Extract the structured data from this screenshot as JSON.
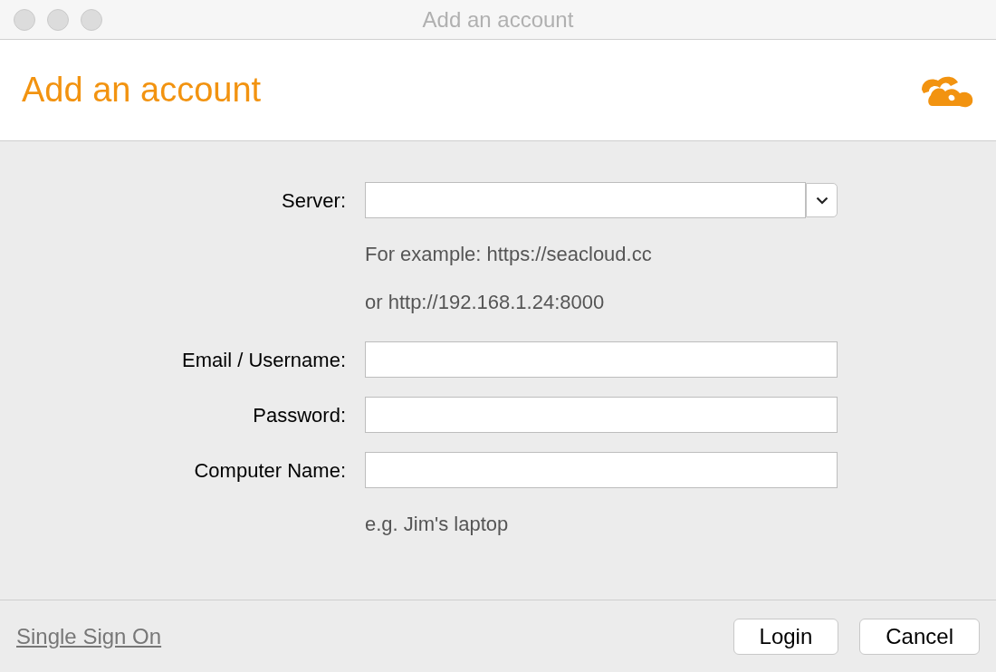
{
  "window": {
    "title": "Add an account"
  },
  "header": {
    "title": "Add an account"
  },
  "fields": [
    {
      "label": "Server:",
      "kind": "combo",
      "hints": [
        "For example: https://seacloud.cc",
        "or http://192.168.1.24:8000"
      ]
    },
    {
      "label": "Email / Username:",
      "kind": "text"
    },
    {
      "label": "Password:",
      "kind": "password"
    },
    {
      "label": "Computer Name:",
      "kind": "text",
      "hints": [
        "e.g. Jim's laptop"
      ]
    }
  ],
  "footer": {
    "link": "Single Sign On",
    "buttons": [
      "Login",
      "Cancel"
    ]
  }
}
